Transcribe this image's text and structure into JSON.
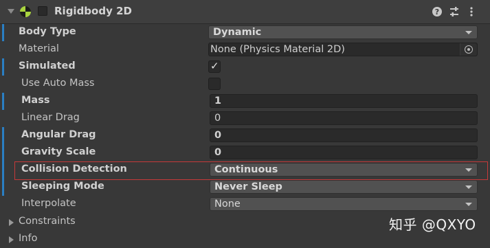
{
  "component": {
    "title": "Rigidbody 2D",
    "icons": [
      "rigidbody2d-icon",
      "help-icon",
      "presets-icon",
      "more-options-icon"
    ]
  },
  "properties": {
    "body_type": {
      "label": "Body Type",
      "value": "Dynamic"
    },
    "material": {
      "label": "Material",
      "value": "None (Physics Material 2D)"
    },
    "simulated": {
      "label": "Simulated",
      "checked": true,
      "mark": "✓"
    },
    "use_auto_mass": {
      "label": "Use Auto Mass",
      "checked": false
    },
    "mass": {
      "label": "Mass",
      "value": "1"
    },
    "linear_drag": {
      "label": "Linear Drag",
      "value": "0"
    },
    "angular_drag": {
      "label": "Angular Drag",
      "value": "0"
    },
    "gravity_scale": {
      "label": "Gravity Scale",
      "value": "0"
    },
    "collision_detection": {
      "label": "Collision Detection",
      "value": "Continuous"
    },
    "sleeping_mode": {
      "label": "Sleeping Mode",
      "value": "Never Sleep"
    },
    "interpolate": {
      "label": "Interpolate",
      "value": "None"
    }
  },
  "foldouts": {
    "constraints": "Constraints",
    "info": "Info"
  },
  "watermark": "知乎 @QXYO",
  "colors": {
    "background": "#383838",
    "field": "#2a2a2a",
    "dropdown": "#515151",
    "modified_bar": "#2a7fc4",
    "highlight_border": "#c63a3a"
  }
}
